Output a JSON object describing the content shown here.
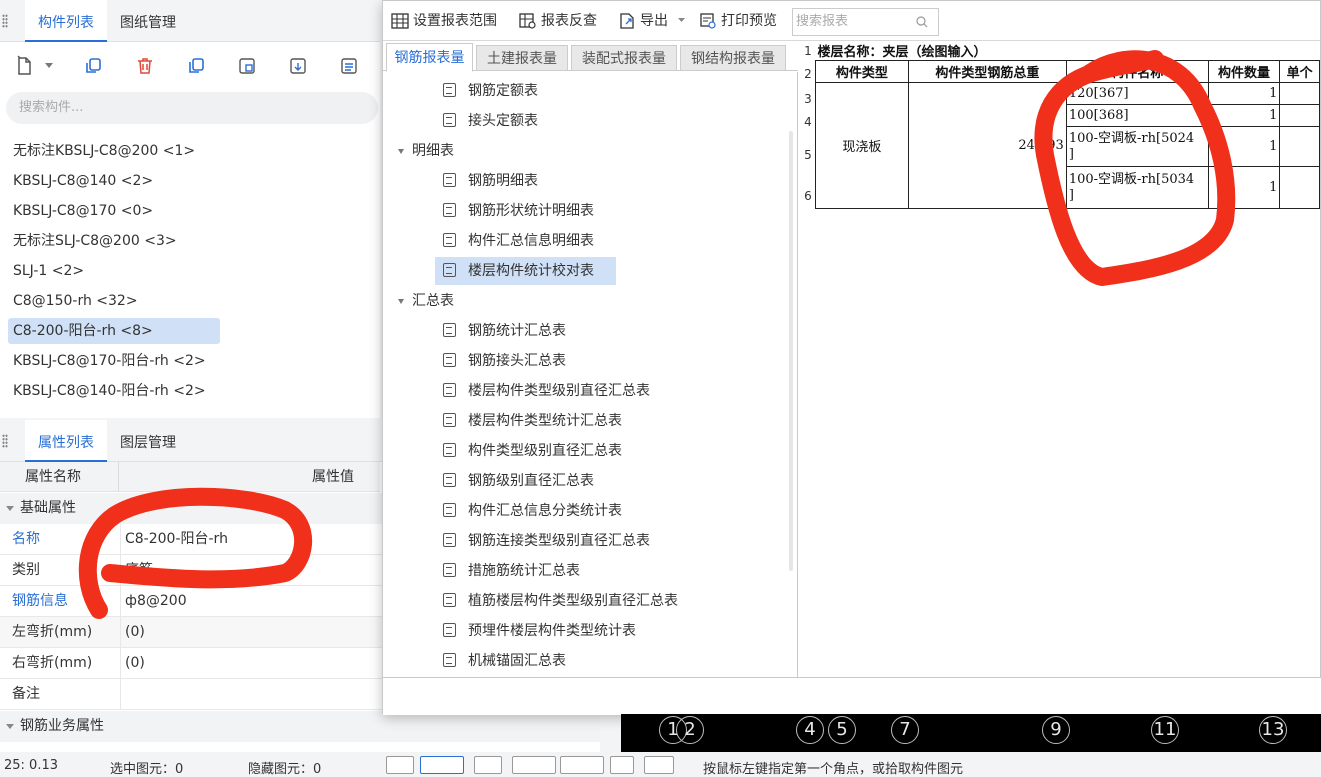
{
  "component_panel": {
    "tabs": [
      "构件列表",
      "图纸管理"
    ],
    "search_placeholder": "搜索构件...",
    "items": [
      "无标注KBSLJ-C8@200 <1>",
      "KBSLJ-C8@140 <2>",
      "KBSLJ-C8@170 <0>",
      "无标注SLJ-C8@200 <3>",
      "SLJ-1 <2>",
      "C8@150-rh <32>",
      "C8-200-阳台-rh <8>",
      "KBSLJ-C8@170-阳台-rh <2>",
      "KBSLJ-C8@140-阳台-rh <2>"
    ],
    "selected_index": 6
  },
  "property_panel": {
    "tabs": [
      "属性列表",
      "图层管理"
    ],
    "col_name": "属性名称",
    "col_value": "属性值",
    "group_basic": "基础属性",
    "rows": [
      {
        "key": "名称",
        "value": "C8-200-阳台-rh",
        "link": true
      },
      {
        "key": "类别",
        "value": "底筋",
        "link": false
      },
      {
        "key": "钢筋信息",
        "value": "ф8@200",
        "link": true
      },
      {
        "key": "左弯折(mm)",
        "value": "(0)",
        "link": false
      },
      {
        "key": "右弯折(mm)",
        "value": "(0)",
        "link": false
      },
      {
        "key": "备注",
        "value": "",
        "link": false
      }
    ],
    "group_business": "钢筋业务属性"
  },
  "report_dialog": {
    "toolbar": {
      "set_range": "设置报表范围",
      "reverse_check": "报表反查",
      "export": "导出",
      "print_preview": "打印预览",
      "search_placeholder": "搜索报表"
    },
    "tabs": [
      "钢筋报表量",
      "土建报表量",
      "装配式报表量",
      "钢结构报表量"
    ],
    "active_tab": 0,
    "tree": [
      {
        "type": "leaf",
        "label": "钢筋定额表"
      },
      {
        "type": "leaf",
        "label": "接头定额表"
      },
      {
        "type": "group",
        "label": "明细表"
      },
      {
        "type": "leaf",
        "label": "钢筋明细表"
      },
      {
        "type": "leaf",
        "label": "钢筋形状统计明细表"
      },
      {
        "type": "leaf",
        "label": "构件汇总信息明细表"
      },
      {
        "type": "leaf",
        "label": "楼层构件统计校对表",
        "selected": true
      },
      {
        "type": "group",
        "label": "汇总表"
      },
      {
        "type": "leaf",
        "label": "钢筋统计汇总表"
      },
      {
        "type": "leaf",
        "label": "钢筋接头汇总表"
      },
      {
        "type": "leaf",
        "label": "楼层构件类型级别直径汇总表"
      },
      {
        "type": "leaf",
        "label": "楼层构件类型统计汇总表"
      },
      {
        "type": "leaf",
        "label": "构件类型级别直径汇总表"
      },
      {
        "type": "leaf",
        "label": "钢筋级别直径汇总表"
      },
      {
        "type": "leaf",
        "label": "构件汇总信息分类统计表"
      },
      {
        "type": "leaf",
        "label": "钢筋连接类型级别直径汇总表"
      },
      {
        "type": "leaf",
        "label": "措施筋统计汇总表"
      },
      {
        "type": "leaf",
        "label": "植筋楼层构件类型级别直径汇总表"
      },
      {
        "type": "leaf",
        "label": "预埋件楼层构件类型统计表"
      },
      {
        "type": "leaf",
        "label": "机械锚固汇总表"
      }
    ]
  },
  "report": {
    "row_numbers": [
      "1",
      "2",
      "3",
      "4",
      "5",
      "6"
    ],
    "floor_title": "楼层名称：夹层（绘图输入）",
    "headers": [
      "构件类型",
      "构件类型钢筋总重",
      "构件名称",
      "构件数量",
      "单个"
    ],
    "type_cell": "现浇板",
    "weight_cell": "24.193",
    "rows": [
      {
        "name": "120[367]",
        "count": "1"
      },
      {
        "name": "100[368]",
        "count": "1"
      },
      {
        "name": "100-空调板-rh[5024\n]",
        "count": "1"
      },
      {
        "name": "100-空调板-rh[5034\n]",
        "count": "1"
      }
    ]
  },
  "axes": [
    "1",
    "2",
    "4",
    "5",
    "7",
    "9",
    "11",
    "13"
  ],
  "status": {
    "coords": "25: 0.13",
    "selected": "选中图元：0",
    "hidden": "隐藏图元：0",
    "hint": "按鼠标左键指定第一个角点，或拾取构件图元"
  },
  "colors": {
    "accent": "#2a6fd6",
    "annotation": "#f0301a",
    "selection": "#cfe0f7"
  }
}
